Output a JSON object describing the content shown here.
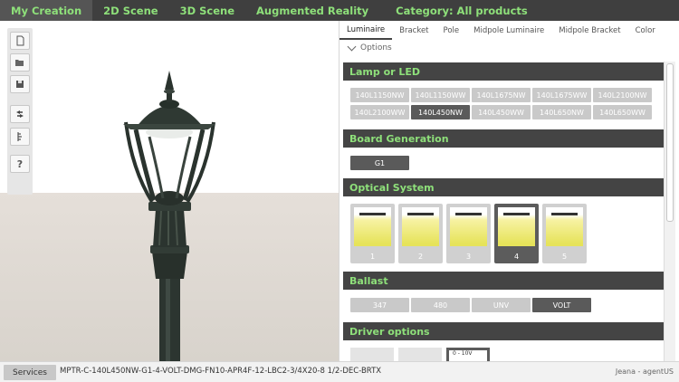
{
  "topnav": {
    "tabs": [
      "My Creation",
      "2D Scene",
      "3D Scene",
      "Augmented Reality"
    ],
    "category": "Category: All products"
  },
  "toolbar": {
    "items": [
      {
        "name": "new-document-icon"
      },
      {
        "name": "open-folder-icon"
      },
      {
        "name": "save-icon"
      },
      {
        "name": "swap-icon"
      },
      {
        "name": "ruler-icon"
      },
      {
        "name": "help-icon",
        "glyph": "?"
      }
    ]
  },
  "subtabs": [
    "Luminaire",
    "Bracket",
    "Pole",
    "Midpole Luminaire",
    "Midpole Bracket",
    "Color"
  ],
  "options_label": "Options",
  "sections": {
    "lamp": {
      "title": "Lamp or LED",
      "options": [
        "140L1150NW",
        "140L1150WW",
        "140L1675NW",
        "140L1675WW",
        "140L2100NW",
        "140L2100WW",
        "140L450NW",
        "140L450WW",
        "140L650NW",
        "140L650WW"
      ],
      "selected": "140L450NW"
    },
    "board": {
      "title": "Board Generation",
      "options": [
        "G1"
      ],
      "selected": "G1"
    },
    "optical": {
      "title": "Optical System",
      "options": [
        "1",
        "2",
        "3",
        "4",
        "5"
      ],
      "selected": "4"
    },
    "ballast": {
      "title": "Ballast",
      "options": [
        "347",
        "480",
        "UNV",
        "VOLT"
      ],
      "selected": "VOLT"
    },
    "driver": {
      "title": "Driver options",
      "visible_label": "0 - 10V"
    }
  },
  "bottombar": {
    "services": "Services",
    "code": "MPTR-C-140L450NW-G1-4-VOLT-DMG-FN10-APR4F-12-LBC2-3/4X20-8 1/2-DEC-BRTX",
    "user": "Jeana - agentUS"
  },
  "colors": {
    "accent": "#8ee07a",
    "dark": "#3f3f3f",
    "option": "#c9c9c9",
    "selected": "#5a5a5a"
  }
}
